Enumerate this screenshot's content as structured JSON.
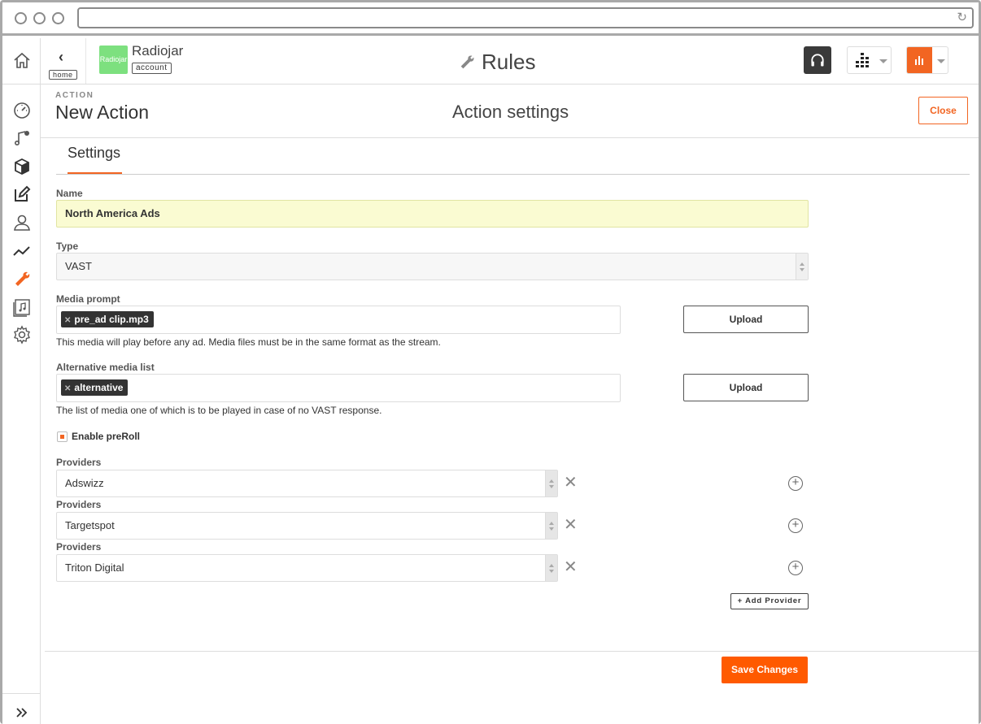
{
  "browser": {
    "url": ""
  },
  "topbar": {
    "back_tag": "home",
    "account_avatar_text": "Radiojar",
    "account_name": "Radiojar",
    "account_tag": "account",
    "page_title": "Rules"
  },
  "action": {
    "kicker": "ACTION",
    "title": "New Action",
    "section_title": "Action settings",
    "close_label": "Close"
  },
  "tabs": {
    "settings": "Settings"
  },
  "form": {
    "name_label": "Name",
    "name_value": "North America Ads",
    "type_label": "Type",
    "type_value": "VAST",
    "media_prompt_label": "Media prompt",
    "media_prompt_chip": "pre_ad clip.mp3",
    "media_prompt_help": "This media will play before any ad. Media files must be in the same format as the stream.",
    "upload_label": "Upload",
    "alt_media_label": "Alternative media list",
    "alt_media_chip": "alternative",
    "alt_media_help": "The list of media one of which is to be played in case of no VAST response.",
    "preroll_label": "Enable preRoll",
    "preroll_checked": true,
    "providers": [
      {
        "label": "Providers",
        "value": "Adswizz"
      },
      {
        "label": "Providers",
        "value": "Targetspot"
      },
      {
        "label": "Providers",
        "value": "Triton Digital"
      }
    ],
    "add_provider_label": "+ Add Provider",
    "save_label": "Save Changes"
  },
  "colors": {
    "accent": "#f26522",
    "save": "#ff5a00",
    "name_bg": "#fafbd2",
    "avatar": "#7de07f"
  }
}
